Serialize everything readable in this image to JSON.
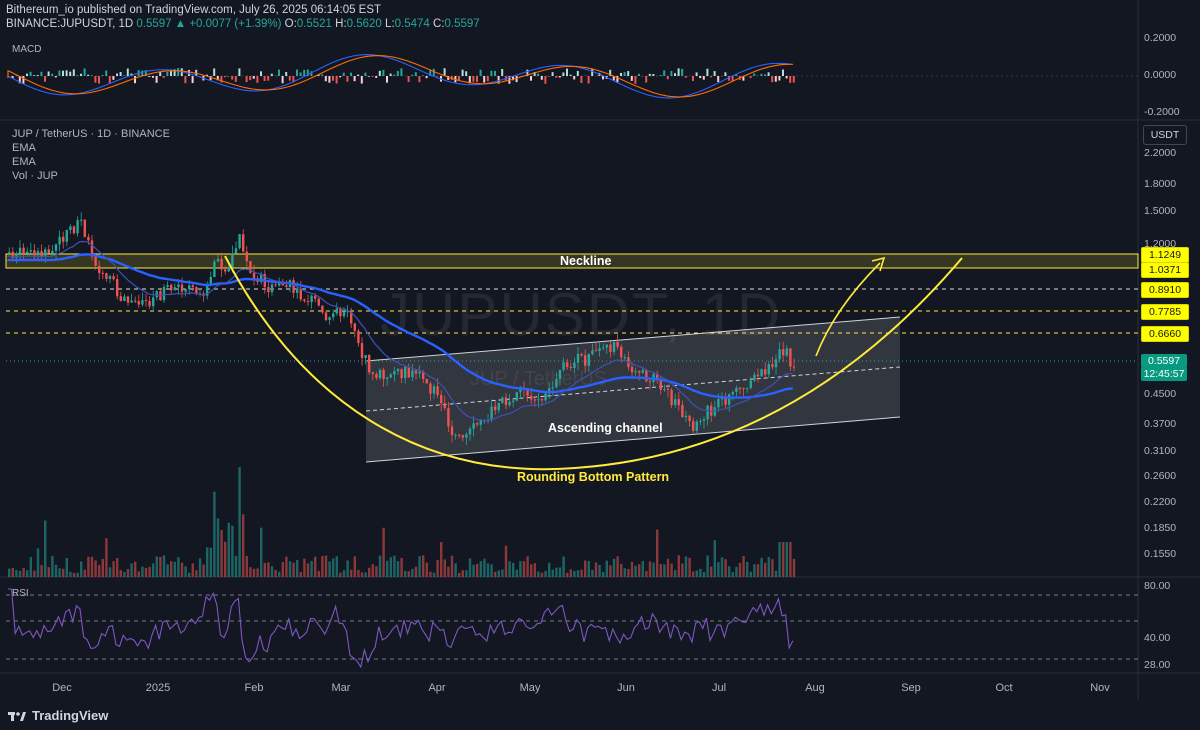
{
  "header": {
    "publisher_line": "Bithereum_io published on TradingView.com, July 26, 2025 06:14:05 EST",
    "symbol": "BINANCE:JUPUSDT, 1D",
    "last": "0.5597",
    "change": "▲ +0.0077 (+1.39%)",
    "o_label": "O:",
    "o_value": "0.5521",
    "h_label": "H:",
    "h_value": "0.5620",
    "l_label": "L:",
    "l_value": "0.5474",
    "c_label": "C:",
    "c_value": "0.5597"
  },
  "macd": {
    "label": "MACD",
    "axis": [
      "0.2000",
      "0.0000",
      "-0.2000"
    ]
  },
  "main": {
    "legend": [
      "JUP / TetherUS · 1D · BINANCE",
      "EMA",
      "EMA",
      "Vol · JUP"
    ],
    "currency": "USDT",
    "axis": [
      "2.2000",
      "1.8000",
      "1.5000",
      "1.2000",
      "0.8910",
      "0.7785",
      "0.4500",
      "0.3700",
      "0.3100",
      "0.2600",
      "0.2200",
      "0.1850",
      "0.1550"
    ],
    "price_tags": [
      "1.1249",
      "1.0371",
      "0.8910",
      "0.7785",
      "0.6660"
    ],
    "last_price": "0.5597",
    "countdown": "12:45:57",
    "watermark": "JUPUSDT, 1D",
    "watermark_sub": "JUP / TetherUS"
  },
  "annotations": {
    "neckline": "Neckline",
    "ascending_channel": "Ascending channel",
    "rounding_bottom": "Rounding Bottom Pattern"
  },
  "rsi": {
    "label": "RSI",
    "axis": [
      "80.00",
      "40.00",
      "28.00"
    ]
  },
  "time_axis": [
    "Dec",
    "2025",
    "Feb",
    "Mar",
    "Apr",
    "May",
    "Jun",
    "Jul",
    "Aug",
    "Sep",
    "Oct",
    "Nov"
  ],
  "footer": {
    "brand": "TradingView"
  },
  "colors": {
    "background": "#131722",
    "up": "#26a69a",
    "down": "#ef5350",
    "ema_slow": "#2962ff",
    "ema_fast": "#3f51b5",
    "annotation": "#ffeb3b",
    "rsi": "#7e57c2"
  },
  "chart_data": {
    "type": "candlestick",
    "price_reference_levels": [
      1.1249,
      1.0371,
      0.891,
      0.7785,
      0.666
    ],
    "last_price": 0.5597,
    "rsi_levels": [
      70,
      50,
      30
    ]
  }
}
